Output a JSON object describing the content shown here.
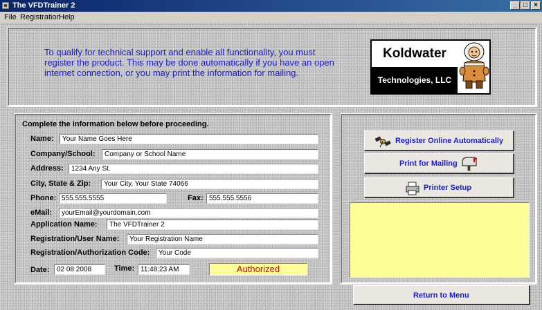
{
  "window": {
    "title": "The VFDTrainer 2",
    "controls": {
      "minimize": "_",
      "maximize": "□",
      "close": "×"
    }
  },
  "menu": [
    "File",
    "Registration",
    "Help"
  ],
  "intro_text": "To qualify for technical support and enable all functionality, you must register the product.  This may be done automatically if you have an open internet connection, or you may print the information for mailing.",
  "logo": {
    "name": "Koldwater",
    "subtitle": "Technologies, LLC",
    "art_icon": "eskimo-mascot-icon"
  },
  "form": {
    "heading": "Complete the information below before proceeding.",
    "name": {
      "label": "Name:",
      "value": "Your Name Goes Here"
    },
    "company": {
      "label": "Company/School:",
      "value": "Company or School Name"
    },
    "address": {
      "label": "Address:",
      "value": "1234 Any St."
    },
    "city": {
      "label": "City, State & Zip:",
      "value": "Your City, Your State 74066"
    },
    "phone": {
      "label": "Phone:",
      "value": "555.555.5555"
    },
    "fax": {
      "label": "Fax:",
      "value": "555.555.5556"
    },
    "email": {
      "label": "eMail:",
      "value": "yourEmail@yourdomain.com"
    },
    "app_name": {
      "label": "Application Name:",
      "value": "The VFDTrainer 2"
    },
    "reg_user": {
      "label": "Registration/User Name:",
      "value": "Your Registration Name"
    },
    "reg_code": {
      "label": "Registration/Authorization Code:",
      "value": "Your Code"
    },
    "date": {
      "label": "Date:",
      "value": "02 08 2008"
    },
    "time": {
      "label": "Time:",
      "value": "11:48:23 AM"
    },
    "status": "Authorized",
    "status_color": "#e00000"
  },
  "actions": {
    "register_online": {
      "label": "Register Online Automatically",
      "icon": "satellite-icon"
    },
    "print_mailing": {
      "label": "Print for Mailing",
      "icon": "mailbox-icon"
    },
    "printer_setup": {
      "label": "Printer Setup",
      "icon": "printer-icon"
    },
    "return_menu": {
      "label": "Return to Menu"
    }
  },
  "colors": {
    "accent_text": "#1a1adb",
    "message_bg": "#ffff99",
    "titlebar": "#0a246a"
  }
}
